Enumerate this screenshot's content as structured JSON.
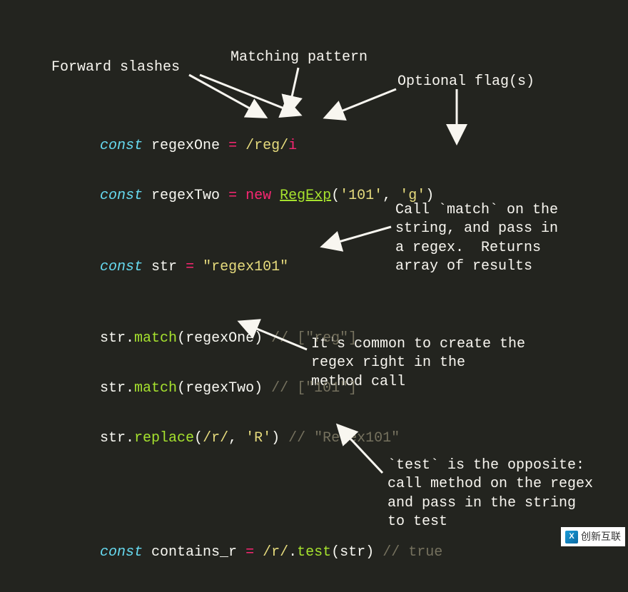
{
  "annotations": {
    "a1": "Forward slashes",
    "a2": "Matching pattern",
    "a3": "Optional flag(s)",
    "a4": "Call `match` on the\nstring, and pass in\na regex.  Returns\narray of results",
    "a5": "It's common to create the\nregex right in the\nmethod call",
    "a6": "`test` is the opposite:\ncall method on the regex\nand pass in the string\nto test"
  },
  "code": {
    "l1": {
      "kw": "const",
      "var": "regexOne",
      "eq": "=",
      "regex": "/reg/",
      "flag": "i"
    },
    "l2": {
      "kw": "const",
      "var": "regexTwo",
      "eq": "=",
      "new": "new",
      "cls": "RegExp",
      "open": "(",
      "s1": "'101'",
      "comma": ", ",
      "s2": "'g'",
      "close": ")"
    },
    "l3": {
      "kw": "const",
      "var": "str",
      "eq": "=",
      "s": "\"regex101\""
    },
    "l4": {
      "obj": "str",
      "dot": ".",
      "fn": "match",
      "open": "(",
      "arg": "regexOne",
      "close": ")",
      "cm": "// [\"reg\"]"
    },
    "l5": {
      "obj": "str",
      "dot": ".",
      "fn": "match",
      "open": "(",
      "arg": "regexTwo",
      "close": ")",
      "cm": "// [\"101\"]"
    },
    "l6": {
      "obj": "str",
      "dot": ".",
      "fn": "replace",
      "open": "(",
      "re": "/r/",
      "comma": ", ",
      "s": "'R'",
      "close": ")",
      "cm": "// \"Regex101\""
    },
    "l7": {
      "kw": "const",
      "var": "contains_r",
      "eq": "=",
      "re": "/r/",
      "dot": ".",
      "fn": "test",
      "open": "(",
      "arg": "str",
      "close": ")",
      "cm": "// true"
    },
    "ws": " "
  },
  "watermark": {
    "text": "创新互联",
    "logo": "X"
  }
}
